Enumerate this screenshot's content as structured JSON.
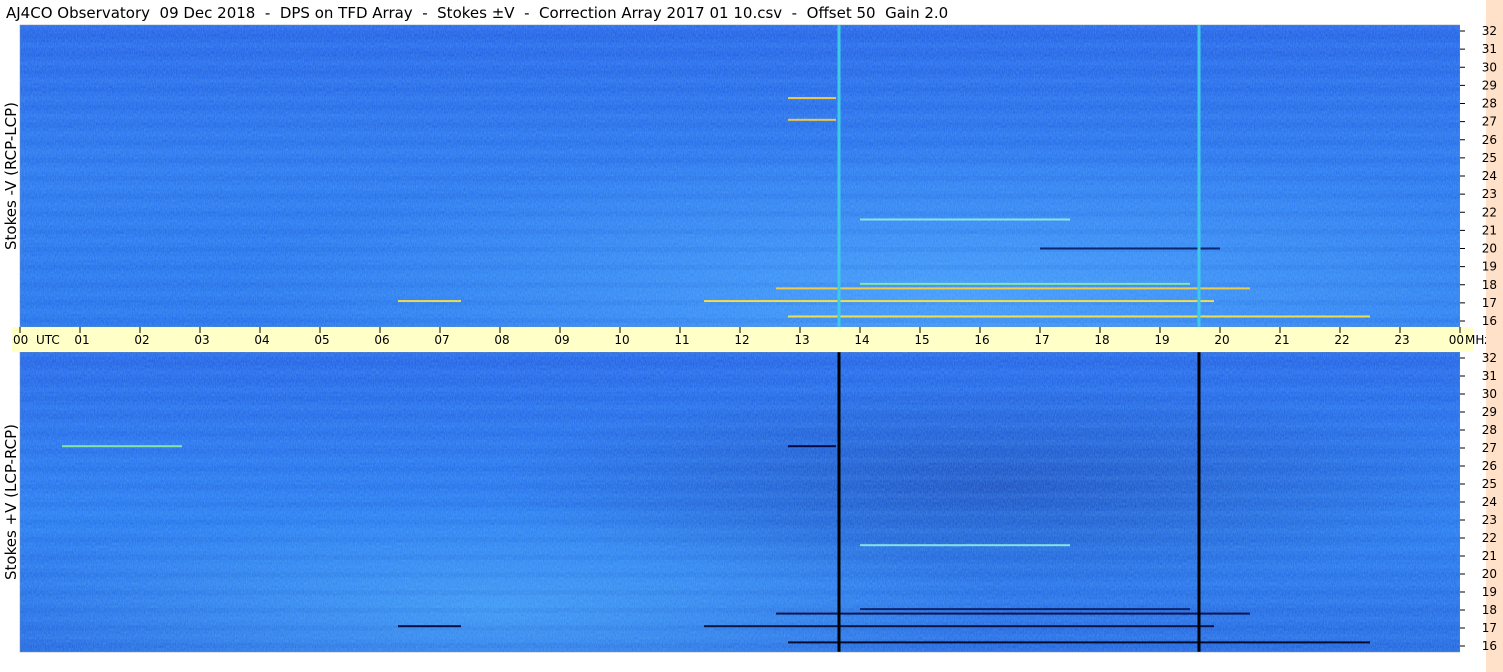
{
  "title": "AJ4CO Observatory  09 Dec 2018  -  DPS on TFD Array  -  Stokes ±V  -  Correction Array 2017 01 10.csv  -  Offset 50  Gain 2.0",
  "chart_data": {
    "type": "heatmap",
    "time_axis": {
      "labels": [
        "00",
        "01",
        "02",
        "03",
        "04",
        "05",
        "06",
        "07",
        "08",
        "09",
        "10",
        "11",
        "12",
        "13",
        "14",
        "15",
        "16",
        "17",
        "18",
        "19",
        "20",
        "21",
        "22",
        "23",
        "00"
      ],
      "unit_label_left": "UTC",
      "unit_label_right": "MHz",
      "range_hours": [
        0,
        24
      ]
    },
    "freq_axis": {
      "labels": [
        "16",
        "17",
        "18",
        "19",
        "20",
        "21",
        "22",
        "23",
        "24",
        "25",
        "26",
        "27",
        "28",
        "29",
        "30",
        "31",
        "32"
      ],
      "range_mhz": [
        16,
        32
      ]
    },
    "panels": [
      {
        "ylabel": "Stokes -V (RCP-LCP)",
        "vertical_lines_hours": [
          13.65,
          19.65
        ],
        "vertical_line_color": "#3ecbe6",
        "horizontal_streaks": [
          {
            "hour_start": 11.4,
            "hour_end": 19.9,
            "mhz": 17.1,
            "color": "#ffe640"
          },
          {
            "hour_start": 12.6,
            "hour_end": 20.5,
            "mhz": 17.8,
            "color": "#ffd23a"
          },
          {
            "hour_start": 14.0,
            "hour_end": 19.5,
            "mhz": 18.05,
            "color": "#8ef0a0"
          },
          {
            "hour_start": 6.3,
            "hour_end": 7.35,
            "mhz": 17.1,
            "color": "#ffe640"
          },
          {
            "hour_start": 12.8,
            "hour_end": 13.6,
            "mhz": 27.1,
            "color": "#ffd23a"
          },
          {
            "hour_start": 12.8,
            "hour_end": 13.6,
            "mhz": 28.3,
            "color": "#ffd23a"
          },
          {
            "hour_start": 14.0,
            "hour_end": 17.5,
            "mhz": 21.6,
            "color": "#8ef0e0"
          },
          {
            "hour_start": 17.0,
            "hour_end": 20.0,
            "mhz": 20.0,
            "color": "#0a1a60"
          },
          {
            "hour_start": 12.8,
            "hour_end": 22.5,
            "mhz": 16.25,
            "color": "#ffe640"
          }
        ]
      },
      {
        "ylabel": "Stokes +V (LCP-RCP)",
        "vertical_lines_hours": [
          13.65,
          19.65
        ],
        "vertical_line_color": "#000000",
        "horizontal_streaks": [
          {
            "hour_start": 11.4,
            "hour_end": 19.9,
            "mhz": 17.1,
            "color": "#0a0a30"
          },
          {
            "hour_start": 12.6,
            "hour_end": 20.5,
            "mhz": 17.8,
            "color": "#0a0a40"
          },
          {
            "hour_start": 14.0,
            "hour_end": 19.5,
            "mhz": 18.05,
            "color": "#0c1c60"
          },
          {
            "hour_start": 6.3,
            "hour_end": 7.35,
            "mhz": 17.1,
            "color": "#000030"
          },
          {
            "hour_start": 12.8,
            "hour_end": 13.6,
            "mhz": 27.1,
            "color": "#000030"
          },
          {
            "hour_start": 0.7,
            "hour_end": 2.7,
            "mhz": 27.1,
            "color": "#8ef0a0"
          },
          {
            "hour_start": 14.0,
            "hour_end": 17.5,
            "mhz": 21.6,
            "color": "#8ef0e0"
          },
          {
            "hour_start": 12.8,
            "hour_end": 22.5,
            "mhz": 16.2,
            "color": "#000018"
          }
        ]
      }
    ]
  }
}
